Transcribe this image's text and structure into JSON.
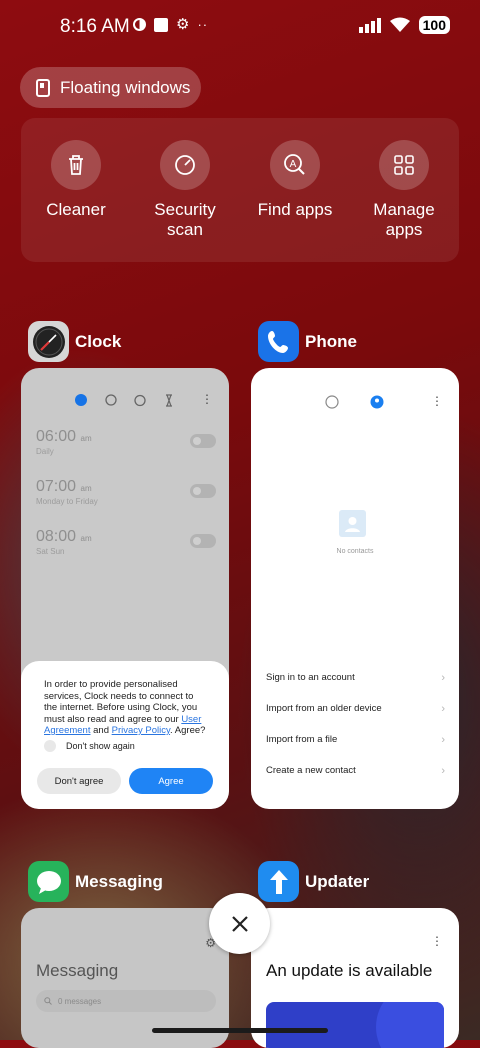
{
  "status_bar": {
    "time": "8:16 AM",
    "battery": "100"
  },
  "floating_windows": {
    "label": "Floating windows"
  },
  "quick_actions": [
    {
      "label": "Cleaner",
      "icon": "trash-icon"
    },
    {
      "label": "Security scan",
      "icon": "security-scan-icon"
    },
    {
      "label": "Find apps",
      "icon": "find-apps-icon"
    },
    {
      "label": "Manage apps",
      "icon": "grid-icon"
    }
  ],
  "apps": {
    "clock": {
      "name": "Clock",
      "alarms": [
        {
          "time": "06:00",
          "suffix": "am",
          "days": "Daily"
        },
        {
          "time": "07:00",
          "suffix": "am",
          "days": "Monday to Friday"
        },
        {
          "time": "08:00",
          "suffix": "am",
          "days": "Sat Sun"
        }
      ],
      "dialog": {
        "text_before": "In order to provide personalised services, Clock needs to connect to the internet. Before using Clock, you must also read and agree to our ",
        "link_user_agreement": "User Agreement",
        "text_and": " and ",
        "link_privacy": "Privacy Policy",
        "text_after": ". Agree?",
        "checkbox_label": "Don't show again",
        "disagree": "Don't agree",
        "agree": "Agree"
      }
    },
    "phone": {
      "name": "Phone",
      "empty_text": "No contacts",
      "links": [
        "Sign in to an account",
        "Import from an older device",
        "Import from a file",
        "Create a new contact"
      ]
    },
    "messaging": {
      "name": "Messaging",
      "title": "Messaging",
      "search_placeholder": "0 messages"
    },
    "updater": {
      "name": "Updater",
      "title": "An update is available"
    }
  },
  "colors": {
    "agree_blue": "#1f84f5",
    "phone_blue": "#1a73e8",
    "messaging_green": "#27b35b"
  }
}
